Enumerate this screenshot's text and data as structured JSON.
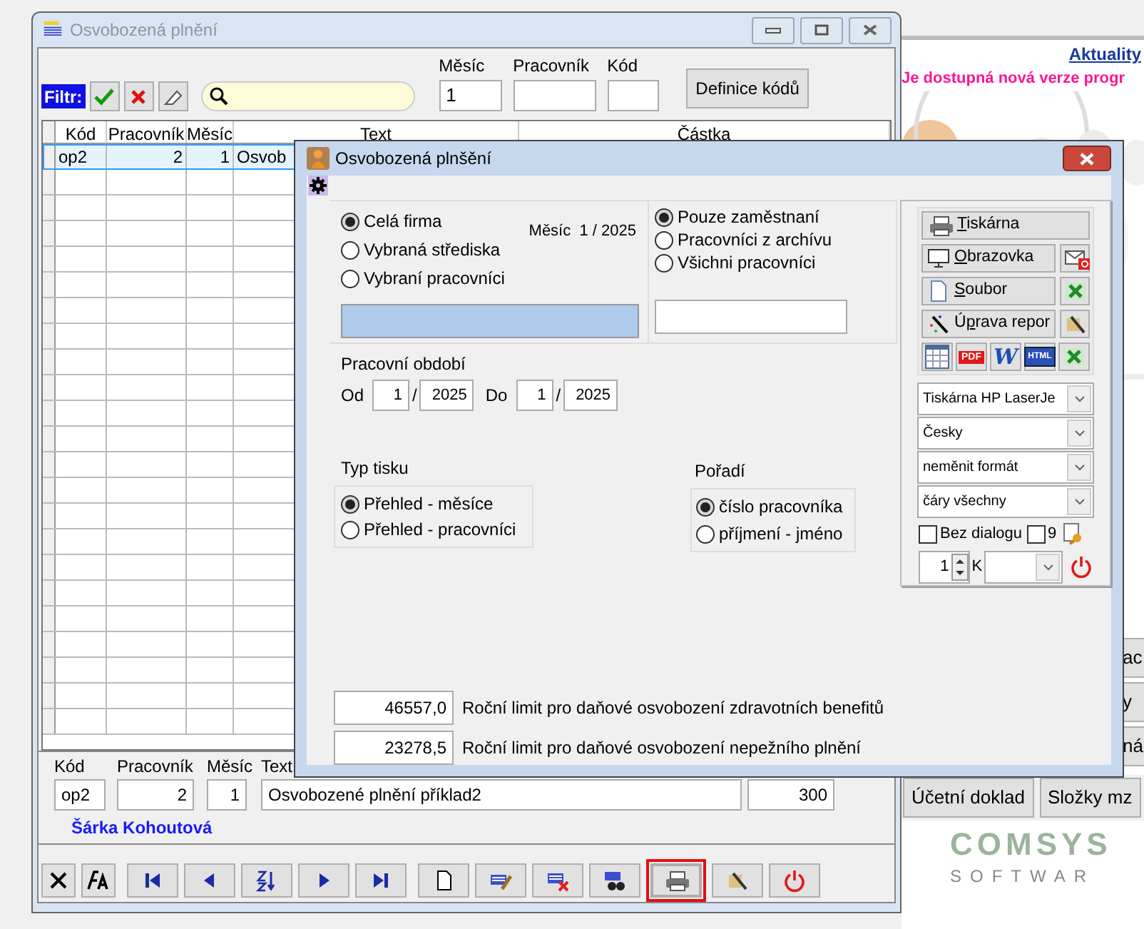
{
  "background_app": {
    "news_link": "Aktuality",
    "notice": "Je dostupná nová verze progr",
    "button_fragments": [
      "ac",
      "y",
      "ná"
    ],
    "buttons": [
      "Účetní doklad",
      "Složky mz"
    ],
    "logo": {
      "top": "COMSYS",
      "bottom": "SOFTWAR"
    }
  },
  "main_window": {
    "title": "Osvobozená plnění",
    "filter": {
      "label": "Filtr:",
      "fields": [
        {
          "label": "Měsíc",
          "value": "1"
        },
        {
          "label": "Pracovník"
        },
        {
          "label": "Kód"
        }
      ],
      "button": "Definice kódů"
    },
    "grid": {
      "columns": [
        "Kód",
        "Pracovník",
        "Měsíc",
        "Text",
        "Částka"
      ],
      "rows": [
        {
          "cells": [
            "op2",
            "2",
            "1",
            "Osvob"
          ],
          "selected": true
        }
      ]
    },
    "detail": {
      "labels": [
        "Kód",
        "Pracovník",
        "Měsíc",
        "Text"
      ],
      "values": [
        "op2",
        "2",
        "1",
        "Osvobozené plnění příklad2",
        "300"
      ],
      "employee": "Šárka Kohoutová"
    },
    "toolbar": [
      {
        "kind": "close",
        "selected": false
      },
      {
        "kind": "font",
        "selected": false
      },
      {
        "kind": "first",
        "selected": false
      },
      {
        "kind": "prev",
        "selected": false
      },
      {
        "kind": "sort",
        "selected": false
      },
      {
        "kind": "next",
        "selected": false
      },
      {
        "kind": "last",
        "selected": false
      },
      {
        "kind": "new",
        "selected": false
      },
      {
        "kind": "edit",
        "selected": false
      },
      {
        "kind": "delete",
        "selected": false
      },
      {
        "kind": "find",
        "selected": false
      },
      {
        "kind": "print",
        "selected": true
      },
      {
        "kind": "tools",
        "selected": false
      },
      {
        "kind": "power",
        "selected": false
      }
    ]
  },
  "dialog": {
    "title": "Osvobozená plnšění",
    "scope": [
      {
        "label": "Celá firma",
        "selected": true
      },
      {
        "label": "Vybraná střediska",
        "selected": false
      },
      {
        "label": "Vybraní pracovníci",
        "selected": false
      }
    ],
    "month_info": "Měsíc  1 / 2025",
    "employees": [
      {
        "label": "Pouze zaměstnaní",
        "selected": true
      },
      {
        "label": "Pracovníci z archívu",
        "selected": false
      },
      {
        "label": "Všichni pracovníci",
        "selected": false
      }
    ],
    "period": {
      "title": "Pracovní období",
      "from_label": "Od",
      "from_month": "1",
      "from_year": "2025",
      "to_label": "Do",
      "to_month": "1",
      "to_year": "2025",
      "separator": "/"
    },
    "print_type": {
      "title": "Typ tisku",
      "options": [
        {
          "label": "Přehled  - měsíce",
          "selected": true
        },
        {
          "label": "Přehled - pracovníci",
          "selected": false
        }
      ]
    },
    "order": {
      "title": "Pořadí",
      "options": [
        {
          "label": "číslo pracovníka",
          "selected": true
        },
        {
          "label": "příjmení - jméno",
          "selected": false
        }
      ]
    },
    "limits": [
      {
        "value": "46557,0",
        "label": "Roční limit pro daňové osvobození zdravotních benefitů"
      },
      {
        "value": "23278,5",
        "label": "Roční limit pro daňové osvobození nepežního plnění"
      }
    ],
    "output": {
      "buttons": [
        {
          "kind": "printer",
          "key": "T",
          "after": "iskárna"
        },
        {
          "kind": "screen",
          "key": "O",
          "after": "brazovka",
          "side_button": {
            "kind": "email"
          }
        },
        {
          "kind": "file",
          "key": "S",
          "after": "oubor",
          "side_button": {
            "kind": "excel"
          }
        },
        {
          "kind": "wand",
          "before": "Ú",
          "key": "p",
          "after": "rava repor",
          "side_button": {
            "kind": "tools"
          }
        }
      ],
      "exports": [
        {
          "kind": "table"
        },
        {
          "kind": "pdf",
          "label": "PDF"
        },
        {
          "kind": "word",
          "label": "W"
        },
        {
          "kind": "html",
          "label": "HTML"
        },
        {
          "kind": "excel"
        }
      ],
      "selects": [
        "Tiskárna HP LaserJe",
        "Česky",
        "neměnit formát",
        "čáry všechny"
      ],
      "checks": [
        {
          "label": "Bez dialogu",
          "checked": false
        },
        {
          "label": "9",
          "checked": false
        }
      ],
      "copies": "1",
      "copies_label": "K"
    }
  }
}
